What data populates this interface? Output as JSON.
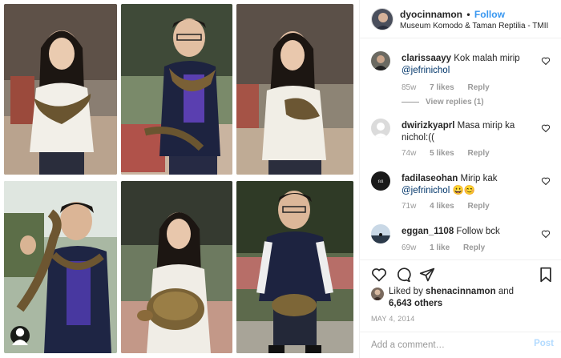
{
  "post": {
    "username": "dyocinnamon",
    "follow_label": "Follow",
    "location": "Museum Komodo & Taman Reptilia - TMII",
    "dot": "•"
  },
  "comments": [
    {
      "user": "clarissaayy",
      "text": "Kok malah mirip",
      "mention": "@jefrinichol",
      "tail": "",
      "time": "85w",
      "likes": "7 likes",
      "reply": "Reply",
      "view_replies": "View replies (1)"
    },
    {
      "user": "dwirizkyaprl",
      "text": "Masa mirip ka nichol:((",
      "mention": "",
      "tail": "",
      "time": "74w",
      "likes": "5 likes",
      "reply": "Reply"
    },
    {
      "user": "fadilaseohan",
      "text": "Mirip kak",
      "mention": "@jefrinichol",
      "tail": "😀😊",
      "time": "71w",
      "likes": "4 likes",
      "reply": "Reply"
    },
    {
      "user": "eggan_1108",
      "text": "Follow bck",
      "mention": "",
      "tail": "",
      "time": "69w",
      "likes": "1 like",
      "reply": "Reply"
    }
  ],
  "likes": {
    "prefix": "Liked by",
    "user": "shenacinnamon",
    "conj": "and",
    "others": "6,643 others"
  },
  "date": "MAY 4, 2014",
  "add_comment": {
    "placeholder": "Add a comment…",
    "post_label": "Post"
  },
  "icons": [
    "heart-icon",
    "comment-icon",
    "share-icon",
    "bookmark-icon",
    "user-tag-icon"
  ]
}
